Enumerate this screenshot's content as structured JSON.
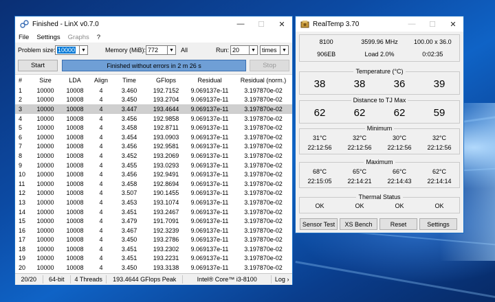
{
  "linx": {
    "title": "Finished - LinX v0.7.0",
    "window_controls": {
      "minimize": "—",
      "maximize": "☐",
      "close": "✕"
    },
    "menu": [
      "File",
      "Settings",
      "Graphs",
      "?"
    ],
    "problem_size_label": "Problem size:",
    "problem_size_value": "10000",
    "memory_label": "Memory (MiB):",
    "memory_value": "772",
    "all_label": "All",
    "run_label": "Run:",
    "run_value": "20",
    "run_unit": "times",
    "start_label": "Start",
    "progress_text": "Finished without errors in 2 m 26 s",
    "progress_fraction": 1.0,
    "stop_label": "Stop",
    "columns": [
      "#",
      "Size",
      "LDA",
      "Align",
      "Time",
      "GFlops",
      "Residual",
      "Residual (norm.)"
    ],
    "rows": [
      [
        "1",
        "10000",
        "10008",
        "4",
        "3.460",
        "192.7152",
        "9.069137e-11",
        "3.197870e-02"
      ],
      [
        "2",
        "10000",
        "10008",
        "4",
        "3.450",
        "193.2704",
        "9.069137e-11",
        "3.197870e-02"
      ],
      [
        "3",
        "10000",
        "10008",
        "4",
        "3.447",
        "193.4644",
        "9.069137e-11",
        "3.197870e-02"
      ],
      [
        "4",
        "10000",
        "10008",
        "4",
        "3.456",
        "192.9858",
        "9.069137e-11",
        "3.197870e-02"
      ],
      [
        "5",
        "10000",
        "10008",
        "4",
        "3.458",
        "192.8711",
        "9.069137e-11",
        "3.197870e-02"
      ],
      [
        "6",
        "10000",
        "10008",
        "4",
        "3.454",
        "193.0903",
        "9.069137e-11",
        "3.197870e-02"
      ],
      [
        "7",
        "10000",
        "10008",
        "4",
        "3.456",
        "192.9581",
        "9.069137e-11",
        "3.197870e-02"
      ],
      [
        "8",
        "10000",
        "10008",
        "4",
        "3.452",
        "193.2069",
        "9.069137e-11",
        "3.197870e-02"
      ],
      [
        "9",
        "10000",
        "10008",
        "4",
        "3.455",
        "193.0293",
        "9.069137e-11",
        "3.197870e-02"
      ],
      [
        "10",
        "10000",
        "10008",
        "4",
        "3.456",
        "192.9491",
        "9.069137e-11",
        "3.197870e-02"
      ],
      [
        "11",
        "10000",
        "10008",
        "4",
        "3.458",
        "192.8694",
        "9.069137e-11",
        "3.197870e-02"
      ],
      [
        "12",
        "10000",
        "10008",
        "4",
        "3.507",
        "190.1455",
        "9.069137e-11",
        "3.197870e-02"
      ],
      [
        "13",
        "10000",
        "10008",
        "4",
        "3.453",
        "193.1074",
        "9.069137e-11",
        "3.197870e-02"
      ],
      [
        "14",
        "10000",
        "10008",
        "4",
        "3.451",
        "193.2467",
        "9.069137e-11",
        "3.197870e-02"
      ],
      [
        "15",
        "10000",
        "10008",
        "4",
        "3.479",
        "191.7091",
        "9.069137e-11",
        "3.197870e-02"
      ],
      [
        "16",
        "10000",
        "10008",
        "4",
        "3.467",
        "192.3239",
        "9.069137e-11",
        "3.197870e-02"
      ],
      [
        "17",
        "10000",
        "10008",
        "4",
        "3.450",
        "193.2786",
        "9.069137e-11",
        "3.197870e-02"
      ],
      [
        "18",
        "10000",
        "10008",
        "4",
        "3.451",
        "193.2302",
        "9.069137e-11",
        "3.197870e-02"
      ],
      [
        "19",
        "10000",
        "10008",
        "4",
        "3.451",
        "193.2231",
        "9.069137e-11",
        "3.197870e-02"
      ],
      [
        "20",
        "10000",
        "10008",
        "4",
        "3.450",
        "193.3138",
        "9.069137e-11",
        "3.197870e-02"
      ]
    ],
    "selected_row": 2,
    "status": {
      "count": "20/20",
      "bits": "64-bit",
      "threads": "4 Threads",
      "peak": "193.4644 GFlops Peak",
      "cpu": "Intel® Core™ i3-8100",
      "log": "Log ›"
    }
  },
  "realtemp": {
    "title": "RealTemp 3.70",
    "window_controls": {
      "minimize": "—",
      "maximize": "☐",
      "close": "✕"
    },
    "info_row1": [
      "8100",
      "3599.96 MHz",
      "100.00 x 36.0"
    ],
    "info_row2": [
      "906EB",
      "Load  2.0%",
      "0:02:35"
    ],
    "temperature_title": "Temperature (°C)",
    "temperatures": [
      "38",
      "38",
      "36",
      "39"
    ],
    "distance_title": "Distance to TJ Max",
    "distances": [
      "62",
      "62",
      "62",
      "59"
    ],
    "minimum_title": "Minimum",
    "minimum_temps": [
      "31°C",
      "32°C",
      "30°C",
      "32°C"
    ],
    "minimum_times": [
      "22:12:56",
      "22:12:56",
      "22:12:56",
      "22:12:56"
    ],
    "maximum_title": "Maximum",
    "maximum_temps": [
      "68°C",
      "65°C",
      "66°C",
      "62°C"
    ],
    "maximum_times": [
      "22:15:05",
      "22:14:21",
      "22:14:43",
      "22:14:14"
    ],
    "thermal_title": "Thermal Status",
    "thermal_status": [
      "OK",
      "OK",
      "OK",
      "OK"
    ],
    "buttons": [
      "Sensor Test",
      "XS Bench",
      "Reset",
      "Settings"
    ]
  },
  "colors": {
    "progress": "#6f9fd6",
    "accent": "#1a6ec4",
    "desktop": "#0c4aa3"
  }
}
